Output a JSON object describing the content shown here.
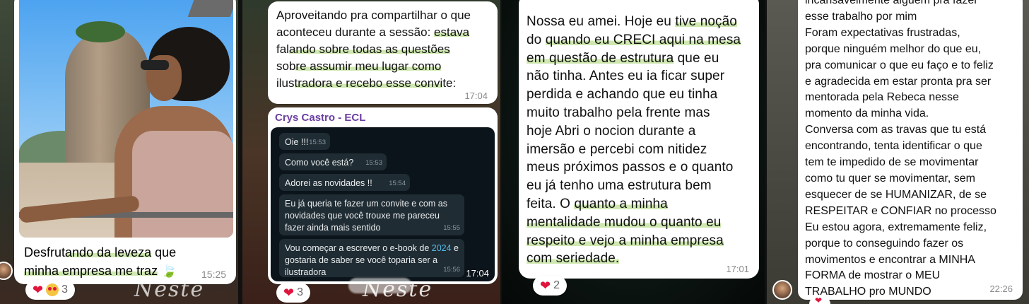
{
  "panel1": {
    "message": {
      "parts": [
        {
          "text": "Desfrut",
          "hl": false
        },
        {
          "text": "ando da leveza",
          "hl": true
        },
        {
          "text": " que",
          "hl": false
        }
      ],
      "line2": [
        {
          "text": "minha empresa me traz",
          "hl": true
        }
      ],
      "emoji": "🍃",
      "time": "15:25"
    },
    "reactions": {
      "count": "3"
    },
    "decor_text": "Neste"
  },
  "panel2": {
    "message": {
      "lines": [
        [
          {
            "text": "Aproveitando pra compartilhar o que",
            "hl": false
          }
        ],
        [
          {
            "text": "aconteceu durante a sessão: ",
            "hl": false
          },
          {
            "text": "estava",
            "hl": true
          }
        ],
        [
          {
            "text": "fal",
            "hl": false
          },
          {
            "text": "ando sobre todas as questões",
            "hl": true
          }
        ],
        [
          {
            "text": "sob",
            "hl": false
          },
          {
            "text": "re assumir meu lugar como",
            "hl": true
          }
        ],
        [
          {
            "text": "ilus",
            "hl": false
          },
          {
            "text": "tradora e recebo esse convi",
            "hl": true
          },
          {
            "text": "te:",
            "hl": false
          }
        ]
      ],
      "time": "17:04"
    },
    "quoted": {
      "sender": "Crys Castro - ECL",
      "sender_color": "#6b3fa0",
      "time": "17:04",
      "inner_messages": [
        {
          "text": "Oie !!!",
          "time": "15:53"
        },
        {
          "text": "Como você está?",
          "time": "15:53"
        },
        {
          "text": "Adorei as novidades !!",
          "time": "15:54"
        },
        {
          "text": "Eu já queria te fazer um convite e com as novidades que você trouxe me pareceu fazer ainda mais sentido",
          "time": "15:55"
        },
        {
          "text_before": "Vou começar a escrever o e-book de ",
          "link": "2024",
          "text_after": " e gostaria de saber se você toparia ser a ilustradora",
          "time": "15:56"
        }
      ]
    },
    "reactions": {
      "count": "3"
    },
    "decor_text": "Neste"
  },
  "panel3": {
    "message": {
      "lines": [
        [
          {
            "text": "Nossa eu amei. Hoje eu ",
            "hl": false
          },
          {
            "text": "tive noção",
            "hl": true
          }
        ],
        [
          {
            "text": "do ",
            "hl": false
          },
          {
            "text": "quando eu CRECI aqui na mesa",
            "hl": true
          }
        ],
        [
          {
            "text": "em questão de estrutura",
            "hl": true
          },
          {
            "text": " que eu",
            "hl": false
          }
        ],
        [
          {
            "text": "não tinha. Antes eu ia ficar super",
            "hl": false
          }
        ],
        [
          {
            "text": "perdida e achando que eu tinha",
            "hl": false
          }
        ],
        [
          {
            "text": "muito trabalho pela frente mas",
            "hl": false
          }
        ],
        [
          {
            "text": "hoje Abri o nocion durante a",
            "hl": false
          }
        ],
        [
          {
            "text": "imersão e percebi com nitidez",
            "hl": false
          }
        ],
        [
          {
            "text": "meus próximos passos e o quanto",
            "hl": false
          }
        ],
        [
          {
            "text": "eu já tenho uma estrutura bem",
            "hl": false
          }
        ],
        [
          {
            "text": "feita. O ",
            "hl": false
          },
          {
            "text": "quanto a minha",
            "hl": true
          }
        ],
        [
          {
            "text": "mentalidade mudou o quanto eu",
            "hl": true
          }
        ],
        [
          {
            "text": "respeito e vejo a minha empresa",
            "hl": true
          }
        ],
        [
          {
            "text": "com seriedade.",
            "hl": true
          }
        ]
      ],
      "time": "17:01"
    },
    "reactions": {
      "count": "2"
    }
  },
  "panel4": {
    "message": {
      "lines": [
        "incansavelmente alguém pra fazer",
        "esse trabalho por mim",
        "Foram expectativas frustradas,",
        "porque ninguém melhor do que eu,",
        "pra comunicar o que eu faço e to feliz",
        "e agradecida em estar pronta pra ser",
        "mentorada pela Rebeca nesse",
        "momento da minha vida.",
        "Conversa com as travas que tu está",
        "encontrando, tenta identificar o que",
        "tem te impedido de se movimentar",
        "como tu quer se movimentar, sem",
        "esquecer de se HUMANIZAR, de se",
        "RESPEITAR e CONFIAR no processo",
        "Eu estou agora, extremamente feliz,",
        "porque to conseguindo fazer os",
        "movimentos e encontrar a MINHA",
        "FORMA de mostrar o MEU",
        "TRABALHO pro MUNDO"
      ],
      "time": "22:26"
    }
  }
}
